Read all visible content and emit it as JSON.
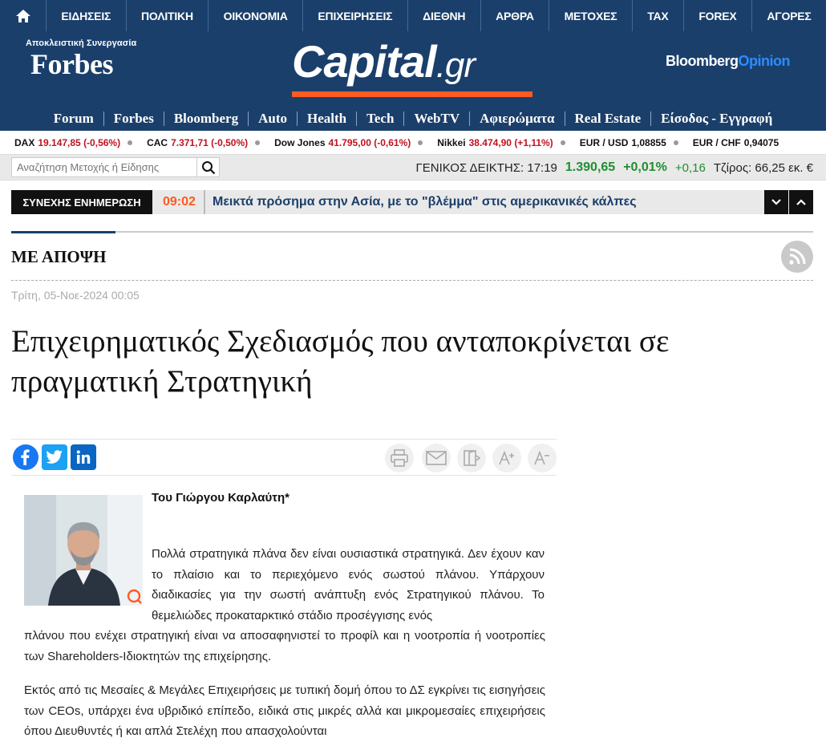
{
  "topnav": {
    "items": [
      "ΕΙΔΗΣΕΙΣ",
      "ΠΟΛΙΤΙΚΗ",
      "ΟΙΚΟΝΟΜΙΑ",
      "ΕΠΙΧΕΙΡΗΣΕΙΣ",
      "ΔΙΕΘΝΗ",
      "ΑΡΘΡΑ",
      "ΜΕΤΟΧΕΣ",
      "TAX",
      "FOREX",
      "ΑΓΟΡΕΣ"
    ]
  },
  "header": {
    "forbes_sub": "Αποκλειστική Συνεργασία",
    "forbes_logo": "Forbes",
    "capital_main": "Capital",
    "capital_suffix": ".gr",
    "bloomberg_main": "Bloomberg",
    "bloomberg_op": "Opinion"
  },
  "subnav": {
    "items": [
      "Forum",
      "Forbes",
      "Bloomberg",
      "Auto",
      "Health",
      "Tech",
      "WebTV",
      "Αφιερώματα",
      "Real Estate",
      "Είσοδος - Εγγραφή"
    ]
  },
  "tickers": [
    {
      "name": "DAX",
      "value": "19.147,85 (-0,56%)",
      "negative": true
    },
    {
      "name": "CAC",
      "value": "7.371,71 (-0,50%)",
      "negative": true
    },
    {
      "name": "Dow Jones",
      "value": "41.795,00 (-0,61%)",
      "negative": true
    },
    {
      "name": "Nikkei",
      "value": "38.474,90 (+1,11%)",
      "negative": true
    },
    {
      "name": "EUR / USD",
      "value": "1,08855",
      "negative": false
    },
    {
      "name": "EUR / CHF",
      "value": "0,94075",
      "negative": false
    }
  ],
  "search": {
    "placeholder": "Αναζήτηση Μετοχής ή Είδησης"
  },
  "index": {
    "label": "ΓΕΝΙΚΟΣ ΔΕΙΚΤΗΣ: 17:19",
    "value": "1.390,65",
    "pct": "+0,01%",
    "change": "+0,16",
    "turnover": "Τζίρος: 66,25 εκ. €"
  },
  "breaking": {
    "tag": "ΣΥΝΕΧΗΣ ΕΝΗΜΕΡΩΣΗ",
    "time": "09:02",
    "headline": "Μεικτά πρόσημα στην Ασία, με το \"βλέμμα\" στις αμερικανικές κάλπες"
  },
  "section": {
    "title": "ΜΕ ΑΠΟΨΗ"
  },
  "article": {
    "date": "Τρίτη, 05-Νοε-2024 00:05",
    "title": "Επιχειρηματικός Σχεδιασμός που ανταποκρίνεται σε πραγματική Στρατηγική",
    "byline": "Του Γιώργου Καρλαύτη*",
    "para1": "Πολλά στρατηγικά πλάνα δεν είναι ουσιαστικά στρατηγικά. Δεν έχουν καν το πλαίσιο και το περιεχόμενο ενός σωστού πλάνου. Υπάρχουν διαδικασίες για την σωστή ανάπτυξη ενός Στρατηγικού πλάνου. Το θεμελιώδες προκαταρκτικό στάδιο προσέγγισης ενός",
    "para1b": "πλάνου που ενέχει στρατηγική είναι να αποσαφηνιστεί το προφίλ και η νοοτροπία ή νοοτροπίες των Shareholders-Ιδιοκτητών της επιχείρησης.",
    "para2": "Εκτός από τις Μεσαίες & Μεγάλες Επιχειρήσεις με τυπική δομή όπου το ΔΣ εγκρίνει τις εισηγήσεις των CEOs, υπάρχει ένα υβριδικό επίπεδο, ειδικά στις μικρές αλλά και μικρομεσαίες επιχειρήσεις όπου Διευθυντές ή και απλά Στελέχη που απασχολούνται"
  },
  "colors": {
    "brand": "#1b3f6b",
    "accent": "#ff5a1f",
    "negative": "#c0121f",
    "positive": "#1f8f2e"
  }
}
